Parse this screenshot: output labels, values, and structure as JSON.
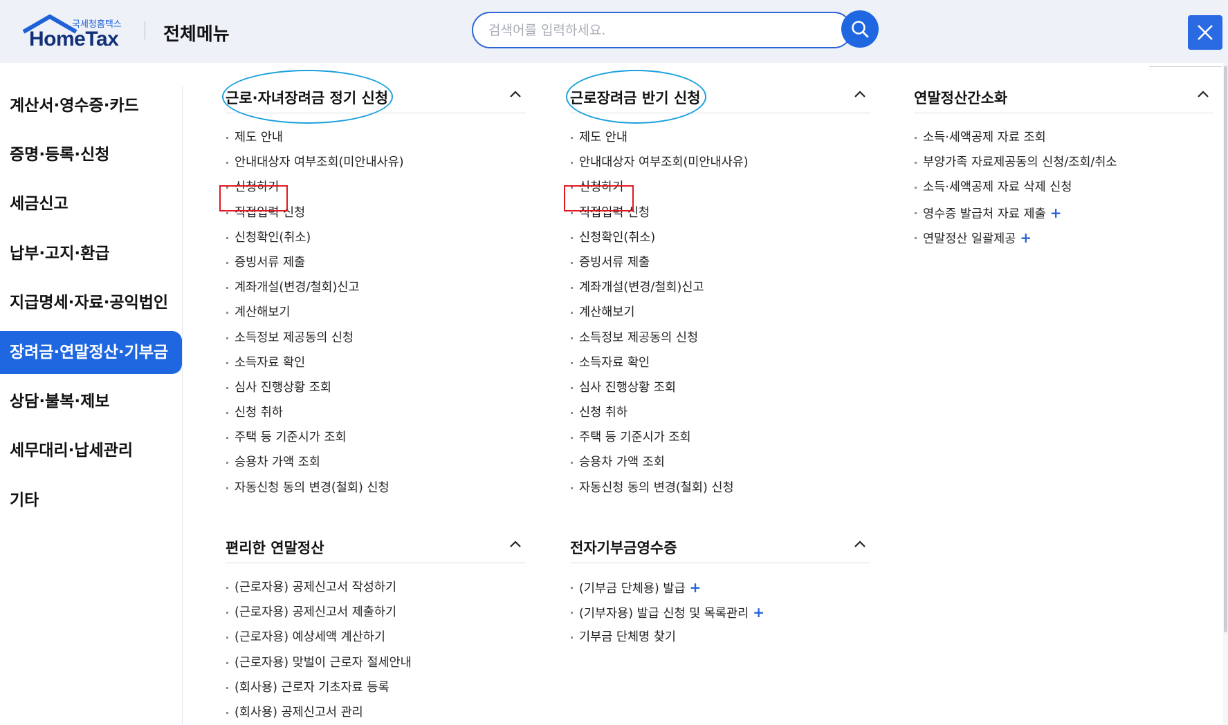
{
  "header": {
    "logo_sub": "국세청홈택스",
    "logo_main": "HomeTax",
    "title": "전체메뉴",
    "search_placeholder": "검색어를 입력하세요."
  },
  "sidebar": {
    "items": [
      {
        "label": "계산서·영수증·카드"
      },
      {
        "label": "증명·등록·신청"
      },
      {
        "label": "세금신고"
      },
      {
        "label": "납부·고지·환급"
      },
      {
        "label": "지급명세·자료·공익법인"
      },
      {
        "label": "장려금·연말정산·기부금",
        "active": true
      },
      {
        "label": "상담·불복·제보"
      },
      {
        "label": "세무대리·납세관리"
      },
      {
        "label": "기타"
      }
    ]
  },
  "sections": {
    "s1": {
      "title": "근로·자녀장려금 정기 신청",
      "items": [
        "제도 안내",
        "안내대상자 여부조회(미안내사유)",
        "신청하기",
        "직접입력 신청",
        "신청확인(취소)",
        "증빙서류 제출",
        "계좌개설(변경/철회)신고",
        "계산해보기",
        "소득정보 제공동의 신청",
        "소득자료 확인",
        "심사 진행상황 조회",
        "신청 취하",
        "주택 등 기준시가 조회",
        "승용차 가액 조회",
        "자동신청 동의 변경(철회) 신청"
      ]
    },
    "s2": {
      "title": "근로장려금 반기 신청",
      "items": [
        "제도 안내",
        "안내대상자 여부조회(미안내사유)",
        "신청하기",
        "직접입력 신청",
        "신청확인(취소)",
        "증빙서류 제출",
        "계좌개설(변경/철회)신고",
        "계산해보기",
        "소득정보 제공동의 신청",
        "소득자료 확인",
        "심사 진행상황 조회",
        "신청 취하",
        "주택 등 기준시가 조회",
        "승용차 가액 조회",
        "자동신청 동의 변경(철회) 신청"
      ]
    },
    "s3": {
      "title": "연말정산간소화",
      "items": [
        "소득·세액공제 자료 조회",
        "부양가족 자료제공동의 신청/조회/취소",
        "소득·세액공제 자료 삭제 신청",
        "영수증 발급처 자료 제출",
        "연말정산 일괄제공"
      ],
      "plus_mark": "+"
    },
    "s4": {
      "title": "편리한 연말정산",
      "items": [
        "(근로자용) 공제신고서 작성하기",
        "(근로자용) 공제신고서 제출하기",
        "(근로자용) 예상세액 계산하기",
        "(근로자용) 맞벌이 근로자 절세안내",
        "(회사용) 근로자 기초자료 등록",
        "(회사용) 공제신고서 관리"
      ]
    },
    "s5": {
      "title": "전자기부금영수증",
      "items": [
        "(기부금 단체용) 발급",
        "(기부자용) 발급 신청 및 목록관리",
        "기부금 단체명 찾기"
      ],
      "plus_mark": "+"
    }
  },
  "colors": {
    "accent": "#1f67e0",
    "ellipse_annotation": "#1aa0dd",
    "box_annotation": "#e0181f"
  }
}
